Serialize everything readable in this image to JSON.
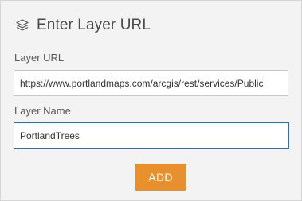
{
  "dialog": {
    "title": "Enter Layer URL",
    "header_icon": "layers-icon"
  },
  "form": {
    "layer_url": {
      "label": "Layer URL",
      "value": "https://www.portlandmaps.com/arcgis/rest/services/Public"
    },
    "layer_name": {
      "label": "Layer Name",
      "value": "PortlandTrees"
    },
    "add_label": "ADD"
  },
  "colors": {
    "accent": "#e8902e",
    "focus_border": "#3e6aa2",
    "panel_background": "#f3f3f3"
  }
}
